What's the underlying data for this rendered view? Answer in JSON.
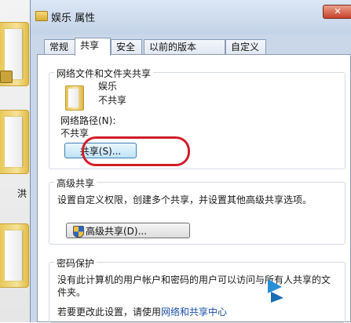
{
  "desktop": {
    "visible_label": "洪"
  },
  "dialog": {
    "title": "娱乐 属性",
    "close_glyph": "✕",
    "tabs": [
      {
        "label": "常规",
        "active": false
      },
      {
        "label": "共享",
        "active": true
      },
      {
        "label": "安全",
        "active": false
      },
      {
        "label": "以前的版本",
        "active": false
      },
      {
        "label": "自定义",
        "active": false
      }
    ]
  },
  "network_sharing": {
    "group_title": "网络文件和文件夹共享",
    "folder_name": "娱乐",
    "folder_status": "不共享",
    "network_path_label": "网络路径(N):",
    "network_path_value": "不共享",
    "share_button": "共享(S)..."
  },
  "advanced_sharing": {
    "group_title": "高级共享",
    "description": "设置自定义权限，创建多个共享，并设置其他高级共享选项。",
    "button": "高级共享(D)..."
  },
  "password_protection": {
    "group_title": "密码保护",
    "description": "没有此计算机的用户帐户和密码的用户可以访问与所有人共享的文件夹。",
    "change_prefix": "若要更改此设置，请使用",
    "link_text": "网络和共享中心"
  },
  "colors": {
    "highlight_ring": "#d21d2b",
    "link": "#1a4fa8",
    "dialog_frame": "#c9d7e9"
  }
}
